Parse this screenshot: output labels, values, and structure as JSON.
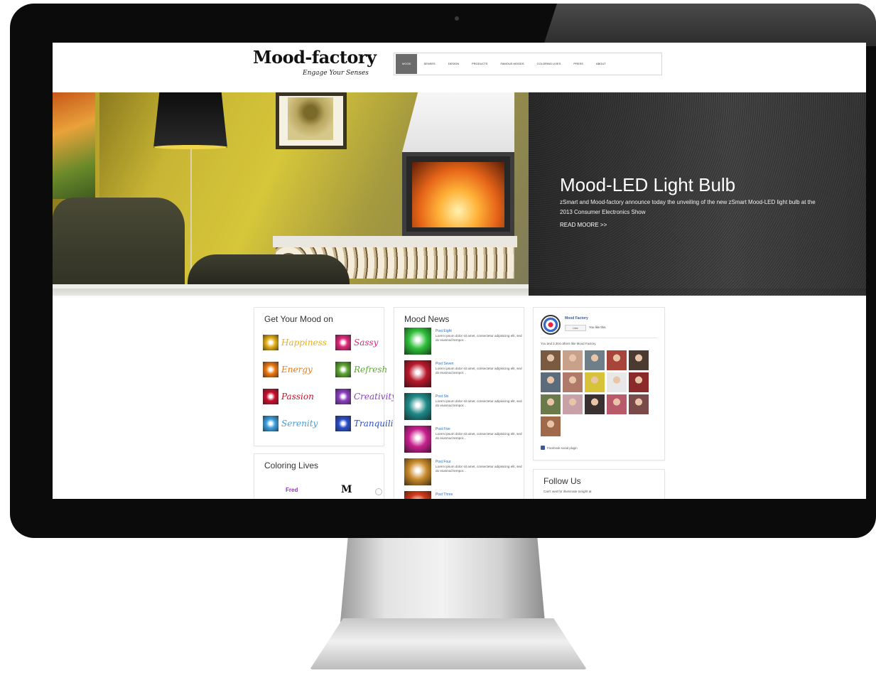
{
  "site": {
    "logo_main": "Mood-factory",
    "logo_tagline": "Engage Your Senses",
    "nav": [
      {
        "label": "MOOD",
        "active": true
      },
      {
        "label": "SENSES",
        "active": false
      },
      {
        "label": "DESIGN",
        "active": false
      },
      {
        "label": "PRODUCTS",
        "active": false
      },
      {
        "label": "FAMOUS MOODS",
        "active": false
      },
      {
        "label": "COLORING LIVES",
        "active": false
      },
      {
        "label": "PRESS",
        "active": false
      },
      {
        "label": "ABOUT",
        "active": false
      }
    ]
  },
  "hero": {
    "title": "Mood-LED Light Bulb",
    "description": "zSmart and Mood-factory announce today the unveiling of the new zSmart Mood-LED light bulb at the 2013 Consumer Electronics Show",
    "read_more": "READ MOORE >>"
  },
  "mood_widget": {
    "title": "Get Your Mood on",
    "moods": [
      {
        "label": "Happiness",
        "color": "#e8b21a",
        "icon": "sunflower-icon"
      },
      {
        "label": "Sassy",
        "color": "#e0287a",
        "icon": "pink-flower-icon"
      },
      {
        "label": "Energy",
        "color": "#f07a12",
        "icon": "orange-burst-icon"
      },
      {
        "label": "Refresh",
        "color": "#5fa832",
        "icon": "green-leaf-icon"
      },
      {
        "label": "Passion",
        "color": "#c8102e",
        "icon": "red-rose-icon"
      },
      {
        "label": "Creativity",
        "color": "#8a3fc0",
        "icon": "purple-swirl-icon"
      },
      {
        "label": "Serenity",
        "color": "#3da0e0",
        "icon": "blue-sky-icon"
      },
      {
        "label": "Tranquility",
        "color": "#2a4fc8",
        "icon": "blue-flower-icon"
      }
    ]
  },
  "coloring_widget": {
    "title": "Coloring Lives",
    "brands": [
      "Fred",
      "M"
    ]
  },
  "news_widget": {
    "title": "Mood News",
    "posts": [
      {
        "title": "Post Eight",
        "excerpt": "Lorem ipsum dolor sit amet, consectetur adipisicing elit, sed do eiusmod tempor...",
        "color": "#2fbf3a"
      },
      {
        "title": "Post Seven",
        "excerpt": "Lorem ipsum dolor sit amet, consectetur adipisicing elit, sed do eiusmod tempor...",
        "color": "#b8182a"
      },
      {
        "title": "Post Six",
        "excerpt": "Lorem ipsum dolor sit amet, consectetur adipisicing elit, sed do eiusmod tempor...",
        "color": "#1f8a88"
      },
      {
        "title": "Post Five",
        "excerpt": "Lorem ipsum dolor sit amet, consectetur adipisicing elit, sed do eiusmod tempor...",
        "color": "#c8208e"
      },
      {
        "title": "Post Four",
        "excerpt": "Lorem ipsum dolor sit amet, consectetur adipisicing elit, sed do eiusmod tempor...",
        "color": "#c98a2a"
      },
      {
        "title": "Post Three",
        "excerpt": "",
        "color": "#d23a18"
      }
    ]
  },
  "facebook_widget": {
    "page_name": "Mood Factory",
    "like_label": "Like",
    "you_like": "You like this.",
    "others_like": "You and 3,304 others like Mood Factory.",
    "plugin_label": "Facebook social plugin",
    "face_colors": [
      "#7a5a40",
      "#c9a08a",
      "#6f7f8a",
      "#a7453a",
      "#4a3a30",
      "#5d6c7c",
      "#b07a6a",
      "#d8c23a",
      "#e8e8e8",
      "#8a2a2a",
      "#6a7a4a",
      "#c8a0a8",
      "#3a3030",
      "#b85a6a",
      "#7a4a4a",
      "#a06a4a"
    ]
  },
  "follow_widget": {
    "title": "Follow Us",
    "subtitle": "Can't wait for illuminate tonight at"
  }
}
